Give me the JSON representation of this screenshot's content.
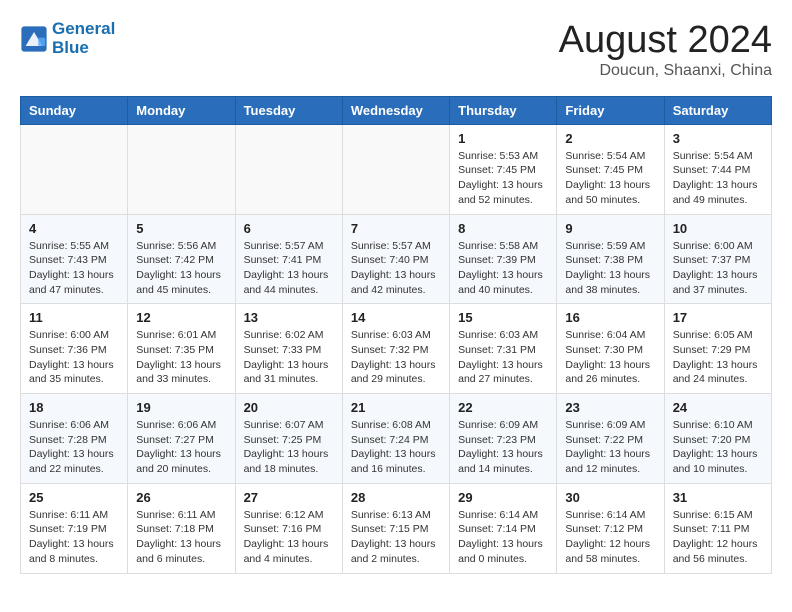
{
  "header": {
    "logo_line1": "General",
    "logo_line2": "Blue",
    "month": "August 2024",
    "location": "Doucun, Shaanxi, China"
  },
  "weekdays": [
    "Sunday",
    "Monday",
    "Tuesday",
    "Wednesday",
    "Thursday",
    "Friday",
    "Saturday"
  ],
  "weeks": [
    [
      {
        "day": "",
        "info": ""
      },
      {
        "day": "",
        "info": ""
      },
      {
        "day": "",
        "info": ""
      },
      {
        "day": "",
        "info": ""
      },
      {
        "day": "1",
        "info": "Sunrise: 5:53 AM\nSunset: 7:45 PM\nDaylight: 13 hours\nand 52 minutes."
      },
      {
        "day": "2",
        "info": "Sunrise: 5:54 AM\nSunset: 7:45 PM\nDaylight: 13 hours\nand 50 minutes."
      },
      {
        "day": "3",
        "info": "Sunrise: 5:54 AM\nSunset: 7:44 PM\nDaylight: 13 hours\nand 49 minutes."
      }
    ],
    [
      {
        "day": "4",
        "info": "Sunrise: 5:55 AM\nSunset: 7:43 PM\nDaylight: 13 hours\nand 47 minutes."
      },
      {
        "day": "5",
        "info": "Sunrise: 5:56 AM\nSunset: 7:42 PM\nDaylight: 13 hours\nand 45 minutes."
      },
      {
        "day": "6",
        "info": "Sunrise: 5:57 AM\nSunset: 7:41 PM\nDaylight: 13 hours\nand 44 minutes."
      },
      {
        "day": "7",
        "info": "Sunrise: 5:57 AM\nSunset: 7:40 PM\nDaylight: 13 hours\nand 42 minutes."
      },
      {
        "day": "8",
        "info": "Sunrise: 5:58 AM\nSunset: 7:39 PM\nDaylight: 13 hours\nand 40 minutes."
      },
      {
        "day": "9",
        "info": "Sunrise: 5:59 AM\nSunset: 7:38 PM\nDaylight: 13 hours\nand 38 minutes."
      },
      {
        "day": "10",
        "info": "Sunrise: 6:00 AM\nSunset: 7:37 PM\nDaylight: 13 hours\nand 37 minutes."
      }
    ],
    [
      {
        "day": "11",
        "info": "Sunrise: 6:00 AM\nSunset: 7:36 PM\nDaylight: 13 hours\nand 35 minutes."
      },
      {
        "day": "12",
        "info": "Sunrise: 6:01 AM\nSunset: 7:35 PM\nDaylight: 13 hours\nand 33 minutes."
      },
      {
        "day": "13",
        "info": "Sunrise: 6:02 AM\nSunset: 7:33 PM\nDaylight: 13 hours\nand 31 minutes."
      },
      {
        "day": "14",
        "info": "Sunrise: 6:03 AM\nSunset: 7:32 PM\nDaylight: 13 hours\nand 29 minutes."
      },
      {
        "day": "15",
        "info": "Sunrise: 6:03 AM\nSunset: 7:31 PM\nDaylight: 13 hours\nand 27 minutes."
      },
      {
        "day": "16",
        "info": "Sunrise: 6:04 AM\nSunset: 7:30 PM\nDaylight: 13 hours\nand 26 minutes."
      },
      {
        "day": "17",
        "info": "Sunrise: 6:05 AM\nSunset: 7:29 PM\nDaylight: 13 hours\nand 24 minutes."
      }
    ],
    [
      {
        "day": "18",
        "info": "Sunrise: 6:06 AM\nSunset: 7:28 PM\nDaylight: 13 hours\nand 22 minutes."
      },
      {
        "day": "19",
        "info": "Sunrise: 6:06 AM\nSunset: 7:27 PM\nDaylight: 13 hours\nand 20 minutes."
      },
      {
        "day": "20",
        "info": "Sunrise: 6:07 AM\nSunset: 7:25 PM\nDaylight: 13 hours\nand 18 minutes."
      },
      {
        "day": "21",
        "info": "Sunrise: 6:08 AM\nSunset: 7:24 PM\nDaylight: 13 hours\nand 16 minutes."
      },
      {
        "day": "22",
        "info": "Sunrise: 6:09 AM\nSunset: 7:23 PM\nDaylight: 13 hours\nand 14 minutes."
      },
      {
        "day": "23",
        "info": "Sunrise: 6:09 AM\nSunset: 7:22 PM\nDaylight: 13 hours\nand 12 minutes."
      },
      {
        "day": "24",
        "info": "Sunrise: 6:10 AM\nSunset: 7:20 PM\nDaylight: 13 hours\nand 10 minutes."
      }
    ],
    [
      {
        "day": "25",
        "info": "Sunrise: 6:11 AM\nSunset: 7:19 PM\nDaylight: 13 hours\nand 8 minutes."
      },
      {
        "day": "26",
        "info": "Sunrise: 6:11 AM\nSunset: 7:18 PM\nDaylight: 13 hours\nand 6 minutes."
      },
      {
        "day": "27",
        "info": "Sunrise: 6:12 AM\nSunset: 7:16 PM\nDaylight: 13 hours\nand 4 minutes."
      },
      {
        "day": "28",
        "info": "Sunrise: 6:13 AM\nSunset: 7:15 PM\nDaylight: 13 hours\nand 2 minutes."
      },
      {
        "day": "29",
        "info": "Sunrise: 6:14 AM\nSunset: 7:14 PM\nDaylight: 13 hours\nand 0 minutes."
      },
      {
        "day": "30",
        "info": "Sunrise: 6:14 AM\nSunset: 7:12 PM\nDaylight: 12 hours\nand 58 minutes."
      },
      {
        "day": "31",
        "info": "Sunrise: 6:15 AM\nSunset: 7:11 PM\nDaylight: 12 hours\nand 56 minutes."
      }
    ]
  ]
}
